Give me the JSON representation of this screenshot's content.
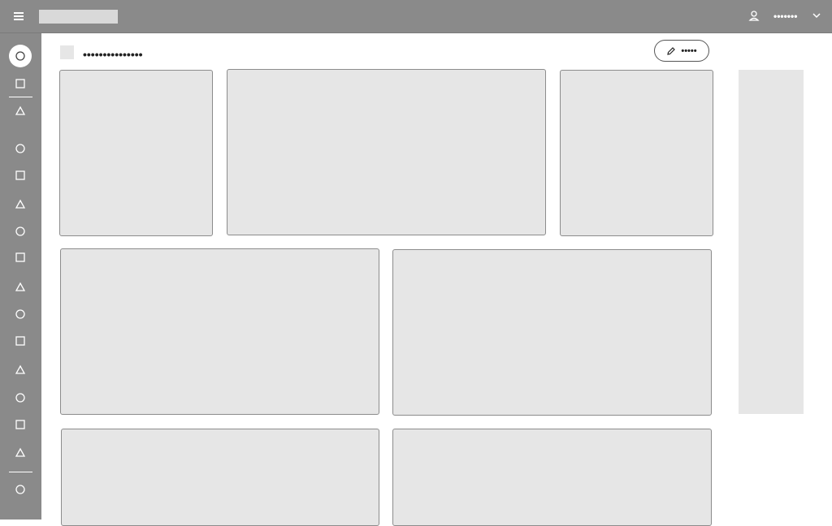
{
  "header": {
    "user_name": "•••••••"
  },
  "page": {
    "title": "•••••••••••••••",
    "edit_label": "•••••"
  },
  "sidebar": {
    "items": [
      {
        "icon": "circle-icon"
      },
      {
        "icon": "square-icon"
      },
      {
        "icon": "triangle-icon"
      },
      {
        "icon": "circle-icon"
      },
      {
        "icon": "square-icon"
      },
      {
        "icon": "triangle-icon"
      },
      {
        "icon": "circle-icon"
      },
      {
        "icon": "square-icon"
      },
      {
        "icon": "triangle-icon"
      },
      {
        "icon": "circle-icon"
      },
      {
        "icon": "square-icon"
      },
      {
        "icon": "triangle-icon"
      },
      {
        "icon": "circle-icon"
      },
      {
        "icon": "square-icon"
      },
      {
        "icon": "triangle-icon"
      },
      {
        "icon": "circle-icon"
      }
    ]
  },
  "colors": {
    "topbar": "#8a8a8a",
    "placeholder": "#e6e6e6",
    "card_border": "#8c8c8c"
  }
}
